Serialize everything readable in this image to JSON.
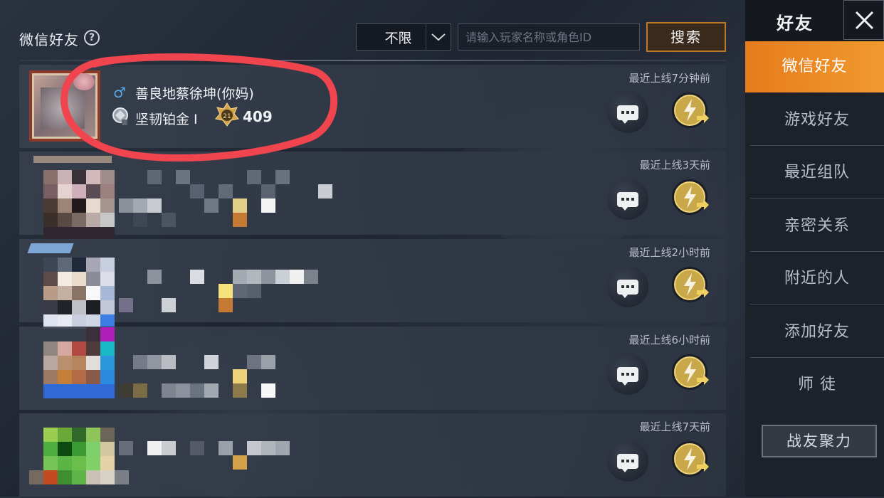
{
  "header": {
    "title": "微信好友",
    "filter_value": "不限",
    "search_placeholder": "请输入玩家名称或角色ID",
    "search_button": "搜索"
  },
  "friends": [
    {
      "name": "善良地蔡徐坤(你妈)",
      "gender_icon": "male-icon",
      "rank": "坚韧铂金 Ⅰ",
      "level": "409",
      "level_badge": "21",
      "last_online": "最近上线7分钟前"
    },
    {
      "last_online": "最近上线3天前"
    },
    {
      "last_online": "最近上线2小时前"
    },
    {
      "last_online": "最近上线6小时前"
    },
    {
      "last_online": "最近上线7天前"
    }
  ],
  "sidebar": {
    "title": "好友",
    "items": [
      {
        "label": "微信好友",
        "active": true
      },
      {
        "label": "游戏好友"
      },
      {
        "label": "最近组队"
      },
      {
        "label": "亲密关系"
      },
      {
        "label": "附近的人"
      },
      {
        "label": "添加好友"
      },
      {
        "label": "师 徒"
      }
    ],
    "team_rally_button": "战友聚力"
  },
  "colors": {
    "accent_orange": "#e77b1b",
    "annotation_red": "#f0454e",
    "gender_blue": "#5aa8e8"
  }
}
